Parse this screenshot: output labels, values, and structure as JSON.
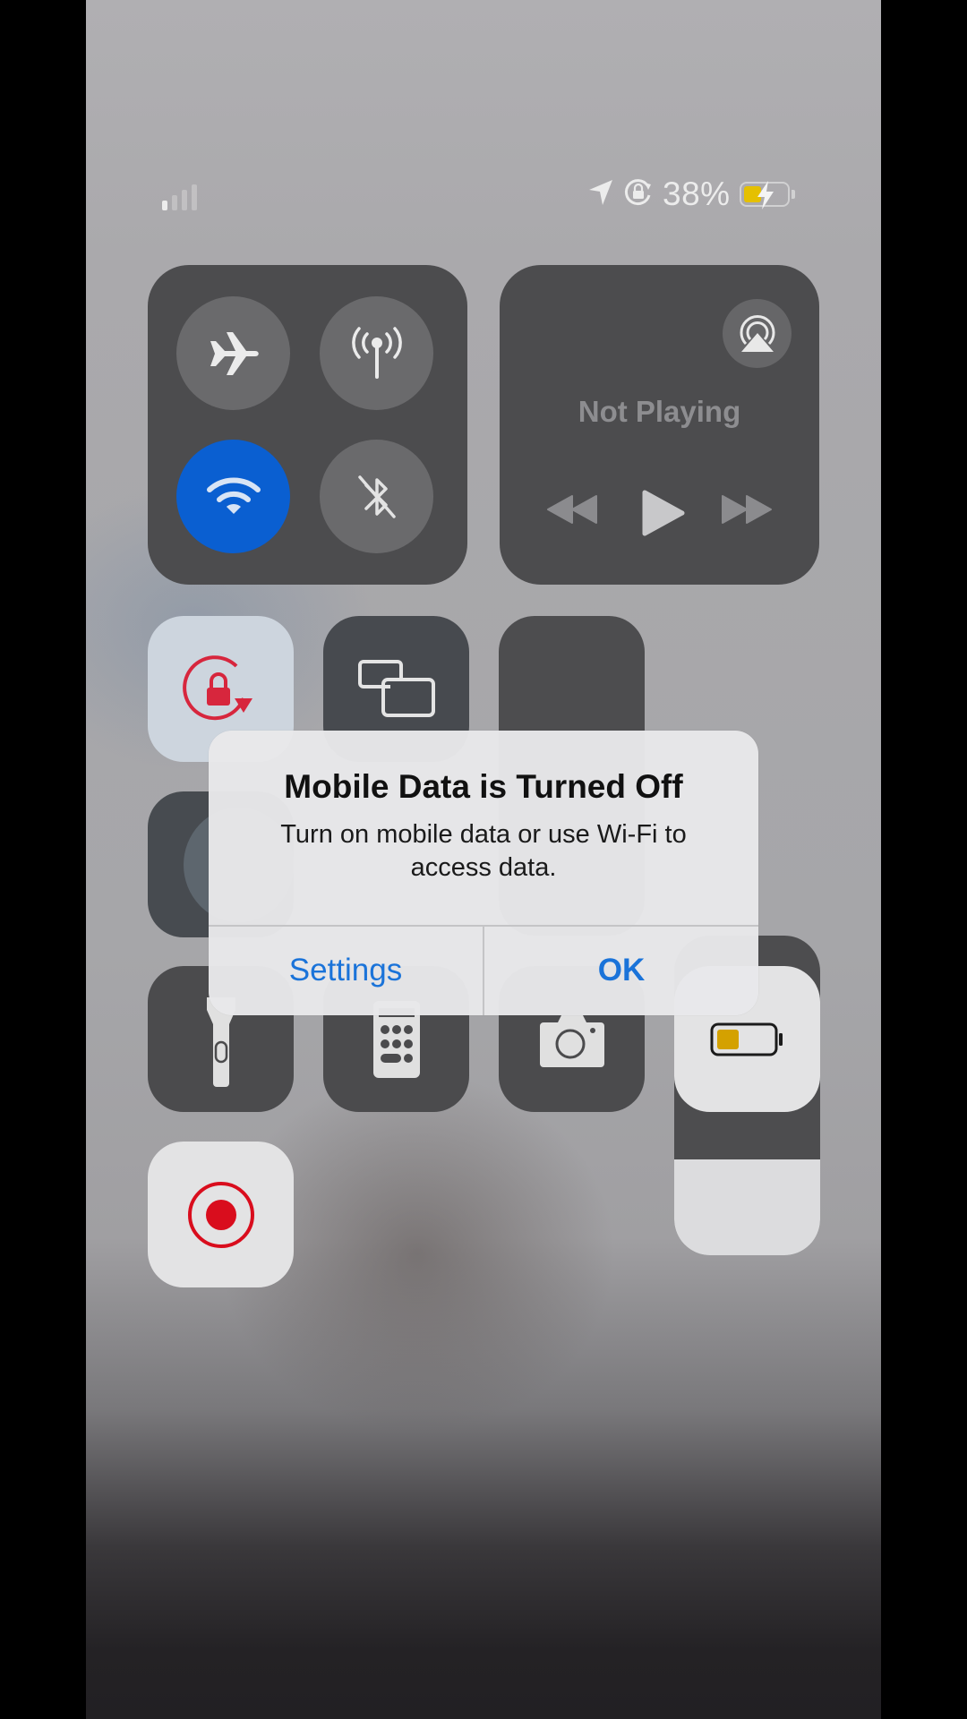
{
  "status_bar": {
    "signal_bars_active": 1,
    "signal_bars_total": 4,
    "icons": [
      "location-arrow-icon",
      "orientation-lock-icon"
    ],
    "battery_percent_label": "38%",
    "battery_level": 0.38,
    "battery_charging": true,
    "battery_fill_color": "#e5c000"
  },
  "connectivity": {
    "airplane_mode": {
      "icon": "airplane-icon",
      "active": false
    },
    "cellular_data": {
      "icon": "cellular-antenna-icon",
      "active": false
    },
    "wifi": {
      "icon": "wifi-icon",
      "active": true,
      "color": "#0a5fd1"
    },
    "bluetooth": {
      "icon": "bluetooth-off-icon",
      "active": false
    }
  },
  "now_playing": {
    "status": "Not Playing",
    "icons": [
      "airplay-icon",
      "rewind-icon",
      "play-icon",
      "fast-forward-icon"
    ]
  },
  "controls": {
    "orientation_lock": {
      "icon": "orientation-lock-icon",
      "active": true,
      "color": "#d7263d"
    },
    "screen_mirroring": {
      "icon": "screen-mirroring-icon"
    },
    "brightness_level": 0.0,
    "volume_level": 0.3,
    "focus": {
      "icon": "moon-icon"
    },
    "flashlight": {
      "icon": "flashlight-icon"
    },
    "calculator": {
      "icon": "calculator-icon"
    },
    "camera": {
      "icon": "camera-icon"
    },
    "low_power_mode": {
      "icon": "battery-icon",
      "active": true,
      "color": "#d4a100"
    },
    "screen_recording": {
      "icon": "record-icon",
      "color": "#d90d1d"
    }
  },
  "alert": {
    "title": "Mobile Data is Turned Off",
    "message": "Turn on mobile data or use Wi-Fi to access data.",
    "buttons": {
      "settings": "Settings",
      "ok": "OK"
    },
    "button_color": "#1a73d9"
  }
}
